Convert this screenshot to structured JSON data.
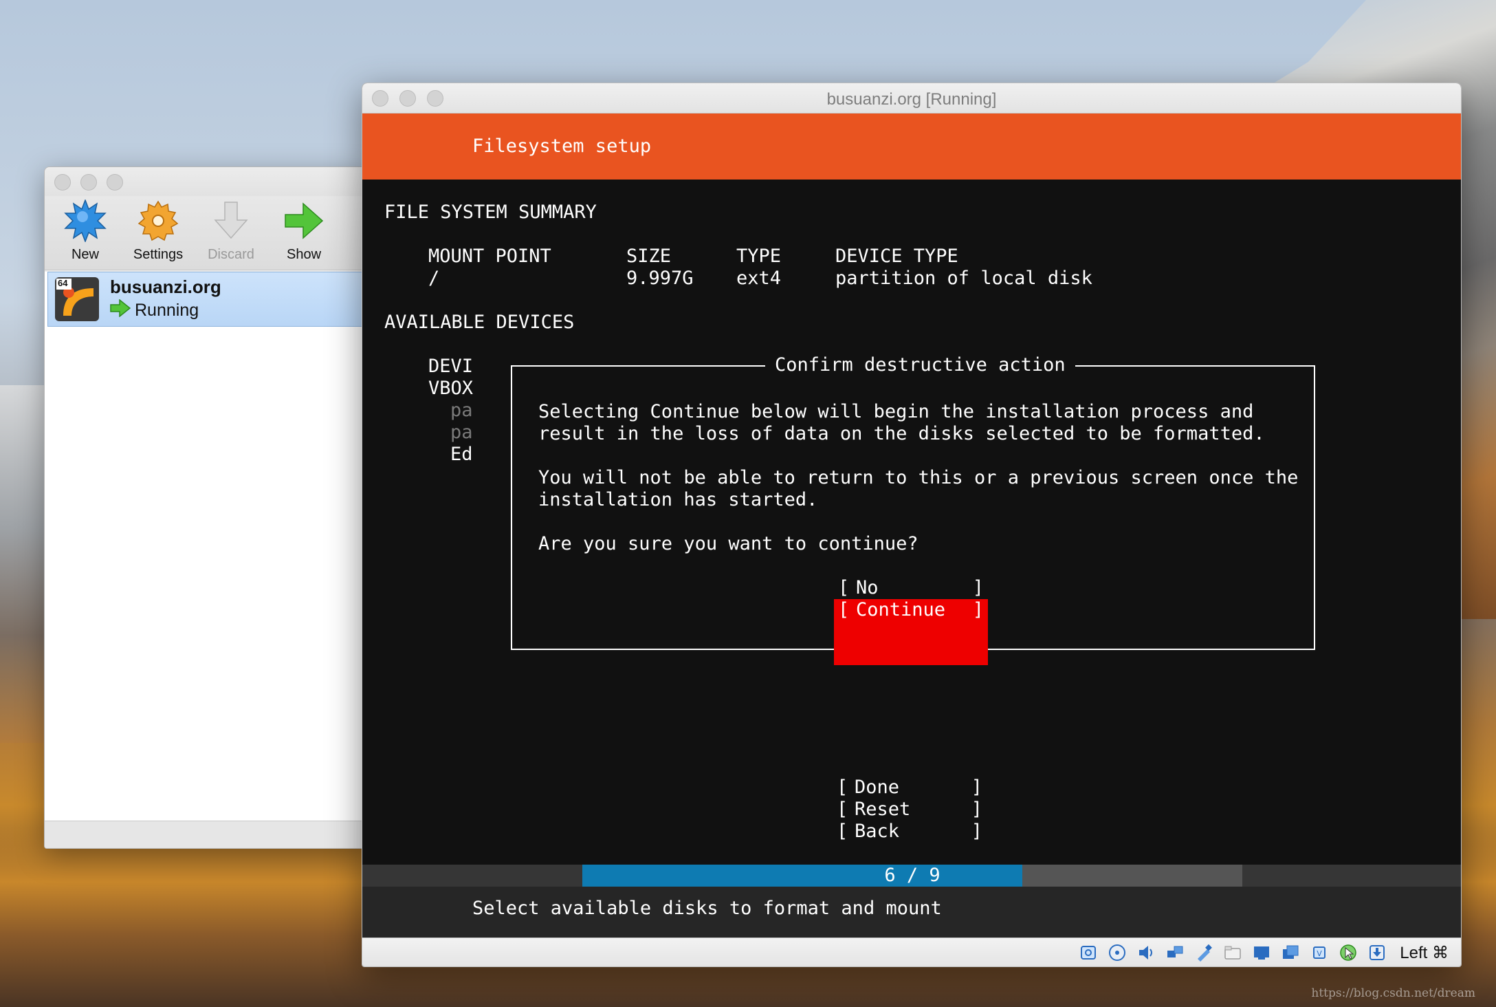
{
  "manager": {
    "toolbar": [
      {
        "label": "New",
        "icon": "new-starburst-icon",
        "enabled": true
      },
      {
        "label": "Settings",
        "icon": "settings-gear-icon",
        "enabled": true
      },
      {
        "label": "Discard",
        "icon": "discard-arrow-icon",
        "enabled": false
      },
      {
        "label": "Show",
        "icon": "show-arrow-icon",
        "enabled": true
      }
    ],
    "vm": {
      "badge": "64",
      "name": "busuanzi.org",
      "state": "Running"
    }
  },
  "window": {
    "title": "busuanzi.org [Running]"
  },
  "installer": {
    "header": "Filesystem setup",
    "summary_title": "FILE SYSTEM SUMMARY",
    "summary_columns": {
      "mount": "MOUNT POINT",
      "size": "SIZE",
      "type": "TYPE",
      "device_type": "DEVICE TYPE"
    },
    "summary_row": {
      "mount": "/",
      "size": "9.997G",
      "type": "ext4",
      "device_type": "partition of local disk"
    },
    "available_title": "AVAILABLE DEVICES",
    "device_fragments": [
      "DEVI",
      "VBOX",
      "pa",
      "pa",
      "Ed"
    ],
    "dialog": {
      "title": "Confirm destructive action",
      "lines": [
        "Selecting Continue below will begin the installation process and",
        "result in the loss of data on the disks selected to be formatted.",
        "You will not be able to return to this or a previous screen once the",
        "installation has started.",
        "Are you sure you want to continue?"
      ],
      "buttons": [
        "No",
        "Continue"
      ],
      "selected": "Continue"
    },
    "actions": [
      "Done",
      "Reset",
      "Back"
    ],
    "progress": {
      "current": 6,
      "total": 9,
      "text": "6 / 9"
    },
    "footer": "Select available disks to format and mount"
  },
  "statusbar": {
    "icons": [
      "hard-disk-icon",
      "optical-drive-icon",
      "audio-icon",
      "network-icon",
      "usb-icon",
      "shared-folders-icon",
      "display-icon",
      "video-capture-icon",
      "cpu-icon",
      "mouse-integration-icon",
      "keyboard-capture-icon"
    ],
    "host_key": "Left ⌘"
  },
  "watermark": "https://blog.csdn.net/dream"
}
